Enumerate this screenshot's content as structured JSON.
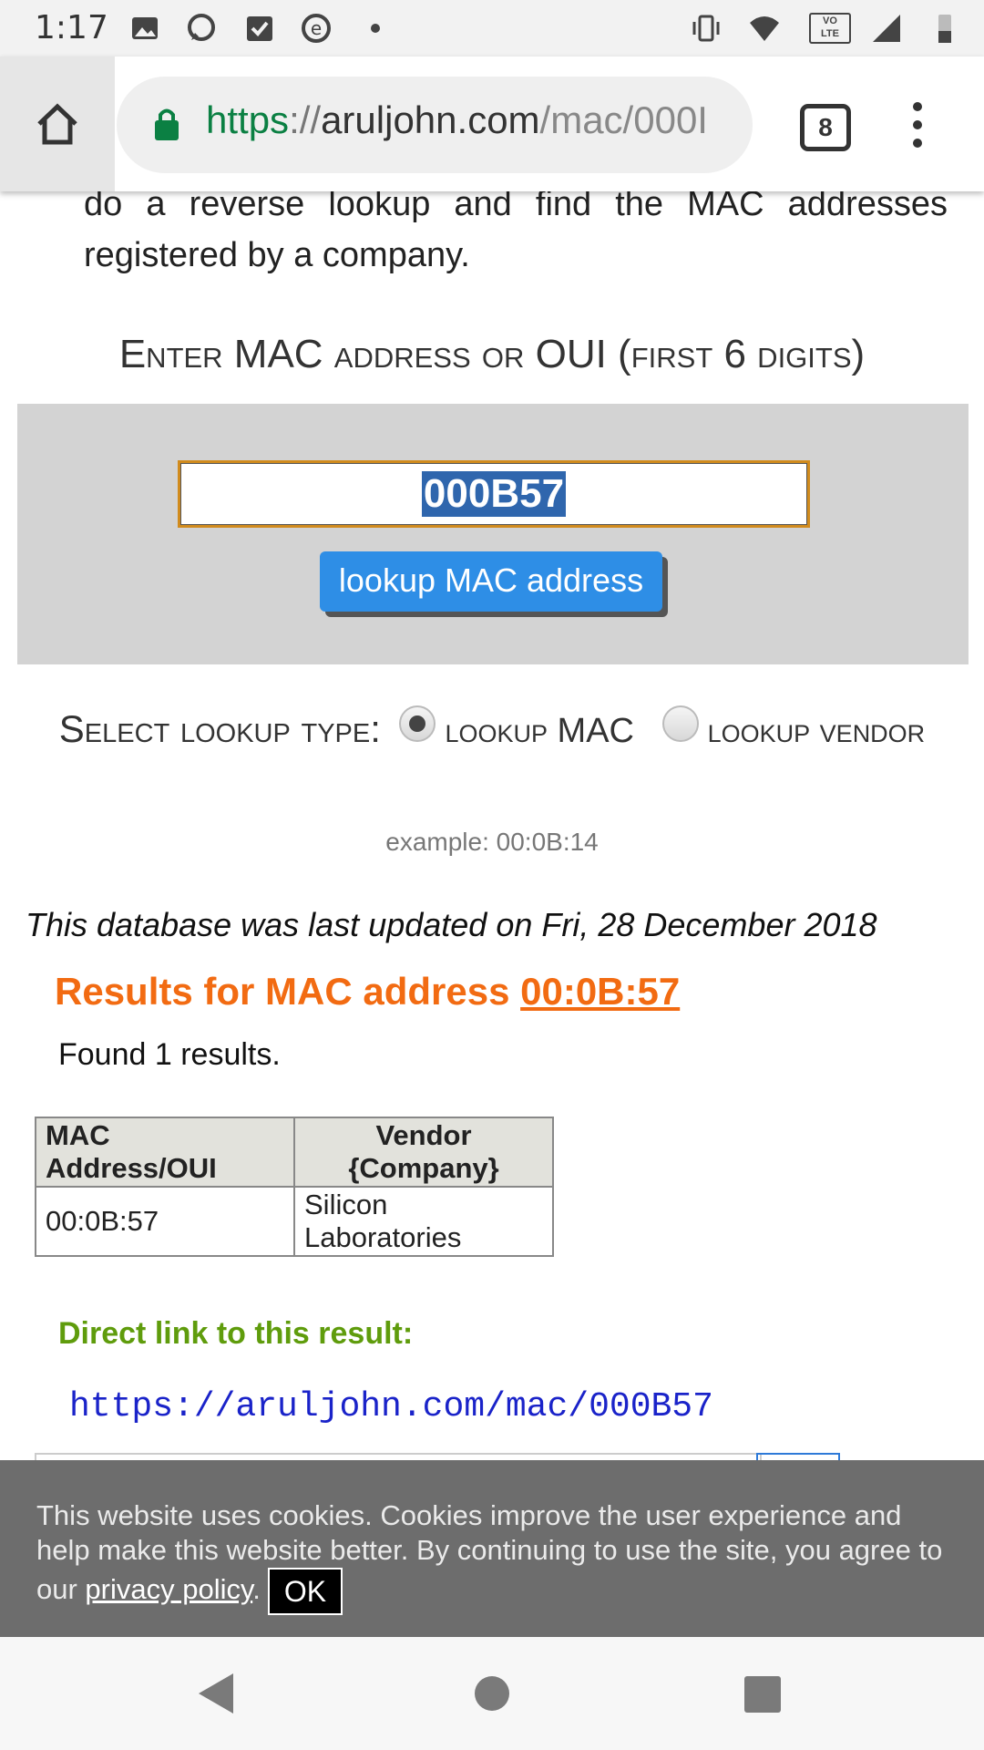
{
  "status_bar": {
    "time": "1:17",
    "icons": [
      "image-icon",
      "chat-icon",
      "check-icon",
      "e-icon",
      "dot-icon",
      "vibrate-icon",
      "wifi-icon",
      "volte-icon",
      "signal-icon",
      "battery-icon"
    ],
    "volte_label_1": "VO",
    "volte_label_2": "LTE"
  },
  "browser": {
    "url_scheme": "https",
    "url_sep": "://",
    "url_host": "aruljohn.com",
    "url_path": "/mac/000I",
    "tab_count": "8"
  },
  "page": {
    "intro_text": "do a reverse lookup and find the MAC addresses registered by a company.",
    "enter_heading": "Enter MAC address or OUI (first 6 digits)",
    "input_value": "000B57",
    "lookup_button": "lookup MAC address",
    "select_type_label": "Select lookup type:",
    "option_mac": "lookup MAC",
    "option_vendor": "lookup vendor",
    "example": "example: 00:0B:14",
    "db_updated": "This database was last updated on Fri, 28 December 2018",
    "results_prefix": "Results for MAC address ",
    "results_mac": "00:0B:57",
    "found": "Found 1 results.",
    "table": {
      "headers": [
        "MAC Address/OUI",
        "Vendor {Company}"
      ],
      "rows": [
        [
          "00:0B:57",
          "Silicon Laboratories"
        ]
      ]
    },
    "direct_link_label": "Direct link to this result:",
    "direct_link_url": "https://aruljohn.com/mac/000B57"
  },
  "cookie_bar": {
    "text_1": "This website uses cookies. Cookies improve the user experience and help make this website better. By continuing to use the site, you agree to our ",
    "privacy_link": "privacy policy",
    "text_2": ".",
    "ok_button": "OK"
  },
  "colors": {
    "accent_button": "#2e8ee6",
    "results_title": "#f26b12",
    "direct_label": "#5f9c0c",
    "link_blue": "#1a23c9"
  }
}
